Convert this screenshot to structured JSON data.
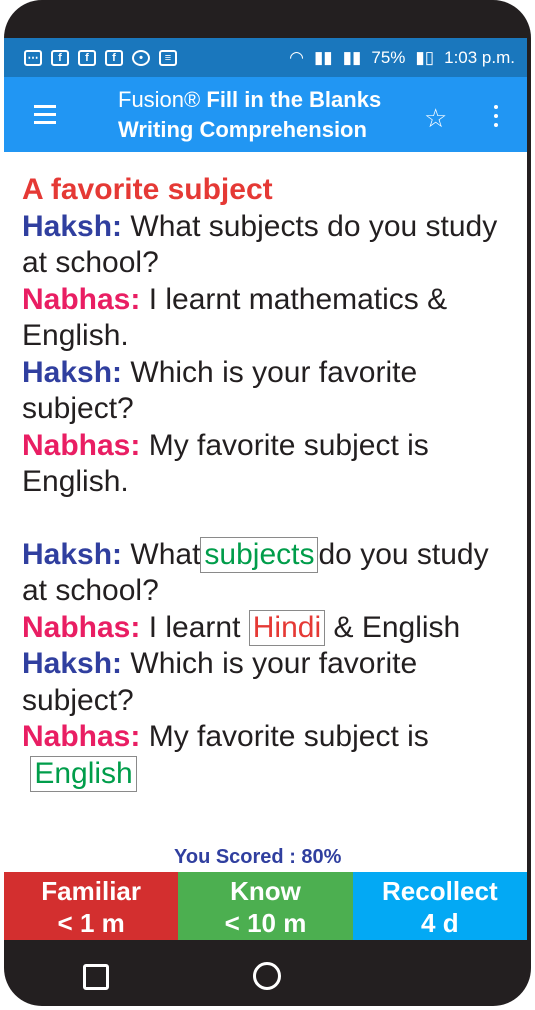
{
  "status_bar": {
    "battery": "75%",
    "time": "1:03 p.m."
  },
  "app_bar": {
    "title_brand": "Fusion®",
    "title_mode": "Fill in the Blanks",
    "subtitle": "Writing Comprehension"
  },
  "passage": {
    "title": "A favorite subject",
    "lines": [
      {
        "speaker": "Haksh:",
        "text": "What subjects do you study at school?"
      },
      {
        "speaker": "Nabhas:",
        "text": "I learnt mathematics & English."
      },
      {
        "speaker": "Haksh:",
        "text": "Which is your favorite subject?"
      },
      {
        "speaker": "Nabhas:",
        "text": "My favorite subject is English."
      }
    ]
  },
  "exercise": {
    "l1_speaker": "Haksh:",
    "l1_pre": "What",
    "l1_blank": "subjects",
    "l1_post": "do you study at school?",
    "l2_speaker": "Nabhas:",
    "l2_pre": "I learnt",
    "l2_blank": "Hindi",
    "l2_post": "& English",
    "l3_speaker": "Haksh:",
    "l3_text": "Which is your favorite subject?",
    "l4_speaker": "Nabhas:",
    "l4_pre": "My favorite subject is",
    "l4_blank": "English"
  },
  "score": "You Scored : 80%",
  "buttons": {
    "familiar_label": "Familiar",
    "familiar_time": "< 1 m",
    "know_label": "Know",
    "know_time": "< 10 m",
    "recollect_label": "Recollect",
    "recollect_time": "4 d"
  }
}
